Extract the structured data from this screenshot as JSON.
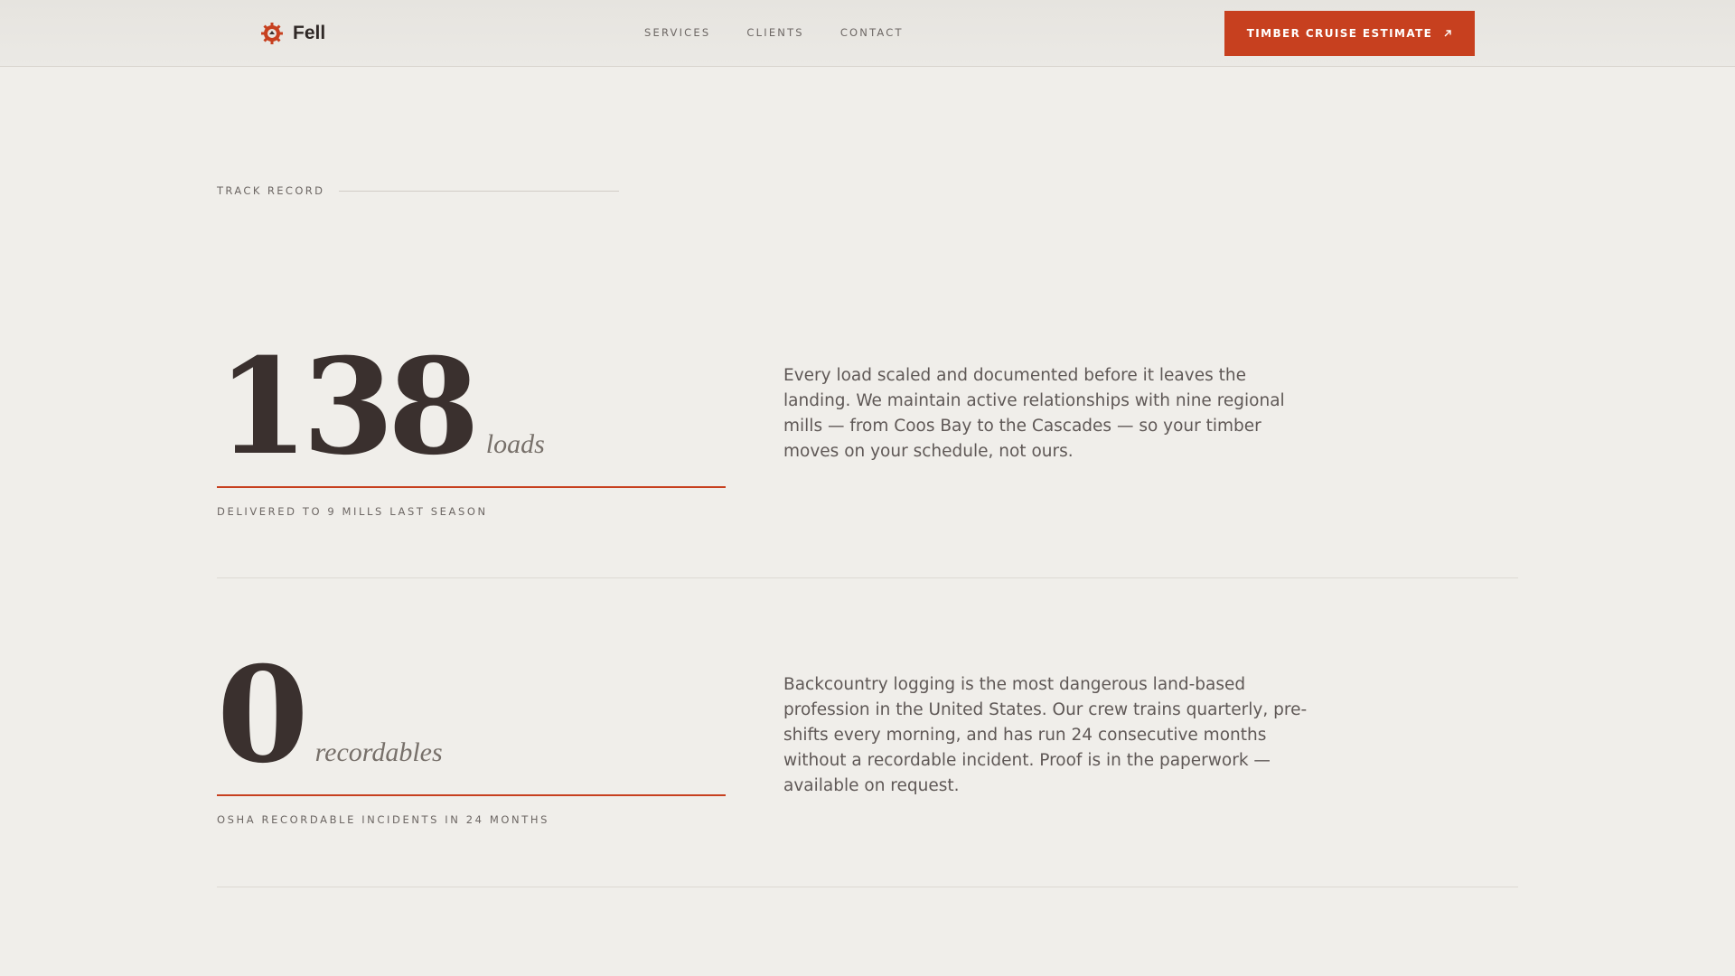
{
  "header": {
    "brand": "Fell",
    "brand_icon": "gear-saw-icon",
    "nav": [
      "SERVICES",
      "CLIENTS",
      "CONTACT"
    ],
    "cta_label": "TIMBER CRUISE ESTIMATE",
    "cta_icon": "arrow-up-right-icon"
  },
  "section": {
    "eyebrow": "TRACK RECORD"
  },
  "stats": [
    {
      "number": "138",
      "unit": "loads",
      "caption": "DELIVERED TO 9 MILLS LAST SEASON",
      "description": "Every load scaled and documented before it leaves the landing. We maintain active relationships with nine regional mills — from Coos Bay to the Cascades — so your timber moves on your schedule, not ours."
    },
    {
      "number": "0",
      "unit": "recordables",
      "caption": "OSHA RECORDABLE INCIDENTS IN 24 MONTHS",
      "description": "Backcountry logging is the most dangerous land-based profession in the United States. Our crew trains quarterly, pre-shifts every morning, and has run 24 consecutive months without a recordable incident. Proof is in the paperwork — available on request."
    }
  ],
  "colors": {
    "accent": "#c7401f",
    "background": "#f0eeea",
    "ink": "#3a302e"
  }
}
